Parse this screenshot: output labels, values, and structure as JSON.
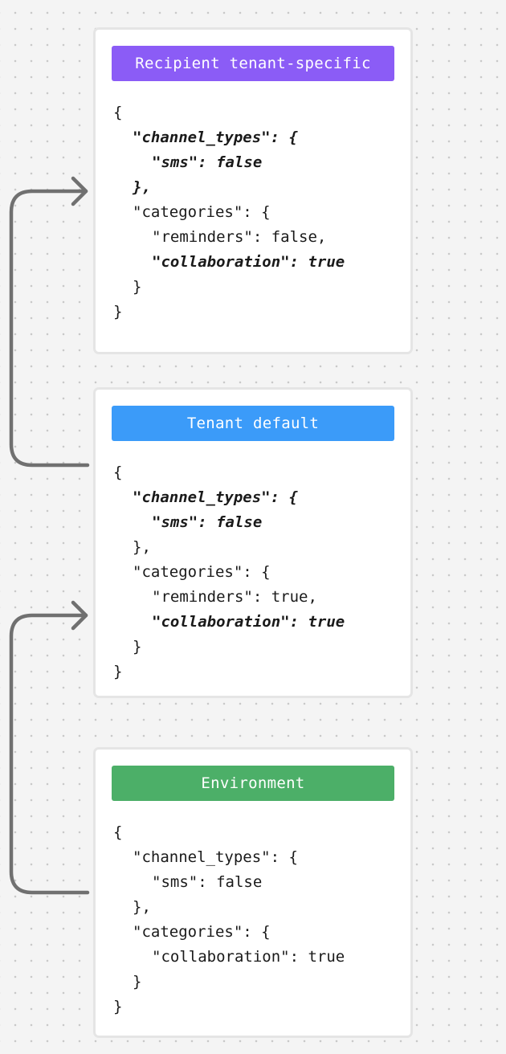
{
  "colors": {
    "recipient_header": "#8b5cf6",
    "tenant_header": "#3b9bf9",
    "environment_header": "#4caf68",
    "arrow": "#707070"
  },
  "cards": [
    {
      "id": "recipient",
      "title": "Recipient tenant-specific",
      "lines": [
        {
          "text": "{",
          "indent": 0,
          "highlight": false
        },
        {
          "text": "\"channel_types\": {",
          "indent": 1,
          "highlight": true
        },
        {
          "text": "\"sms\": false",
          "indent": 2,
          "highlight": true
        },
        {
          "text": "},",
          "indent": 1,
          "highlight": true
        },
        {
          "text": "\"categories\": {",
          "indent": 1,
          "highlight": false
        },
        {
          "text": "\"reminders\": false,",
          "indent": 2,
          "highlight": false
        },
        {
          "text": "\"collaboration\": true",
          "indent": 2,
          "highlight": true
        },
        {
          "text": "}",
          "indent": 1,
          "highlight": false
        },
        {
          "text": "}",
          "indent": 0,
          "highlight": false
        }
      ]
    },
    {
      "id": "tenant",
      "title": "Tenant default",
      "lines": [
        {
          "text": "{",
          "indent": 0,
          "highlight": false
        },
        {
          "text": "\"channel_types\": {",
          "indent": 1,
          "highlight": true
        },
        {
          "text": "\"sms\": false",
          "indent": 2,
          "highlight": true
        },
        {
          "text": "},",
          "indent": 1,
          "highlight": false
        },
        {
          "text": "\"categories\": {",
          "indent": 1,
          "highlight": false
        },
        {
          "text": "\"reminders\": true,",
          "indent": 2,
          "highlight": false
        },
        {
          "text": "\"collaboration\": true",
          "indent": 2,
          "highlight": true
        },
        {
          "text": "}",
          "indent": 1,
          "highlight": false
        },
        {
          "text": "}",
          "indent": 0,
          "highlight": false
        }
      ]
    },
    {
      "id": "environment",
      "title": "Environment",
      "lines": [
        {
          "text": "{",
          "indent": 0,
          "highlight": false
        },
        {
          "text": "\"channel_types\": {",
          "indent": 1,
          "highlight": false
        },
        {
          "text": "\"sms\": false",
          "indent": 2,
          "highlight": false
        },
        {
          "text": "},",
          "indent": 1,
          "highlight": false
        },
        {
          "text": "\"categories\": {",
          "indent": 1,
          "highlight": false
        },
        {
          "text": "\"collaboration\": true",
          "indent": 2,
          "highlight": false
        },
        {
          "text": "}",
          "indent": 1,
          "highlight": false
        },
        {
          "text": "}",
          "indent": 0,
          "highlight": false
        }
      ]
    }
  ]
}
